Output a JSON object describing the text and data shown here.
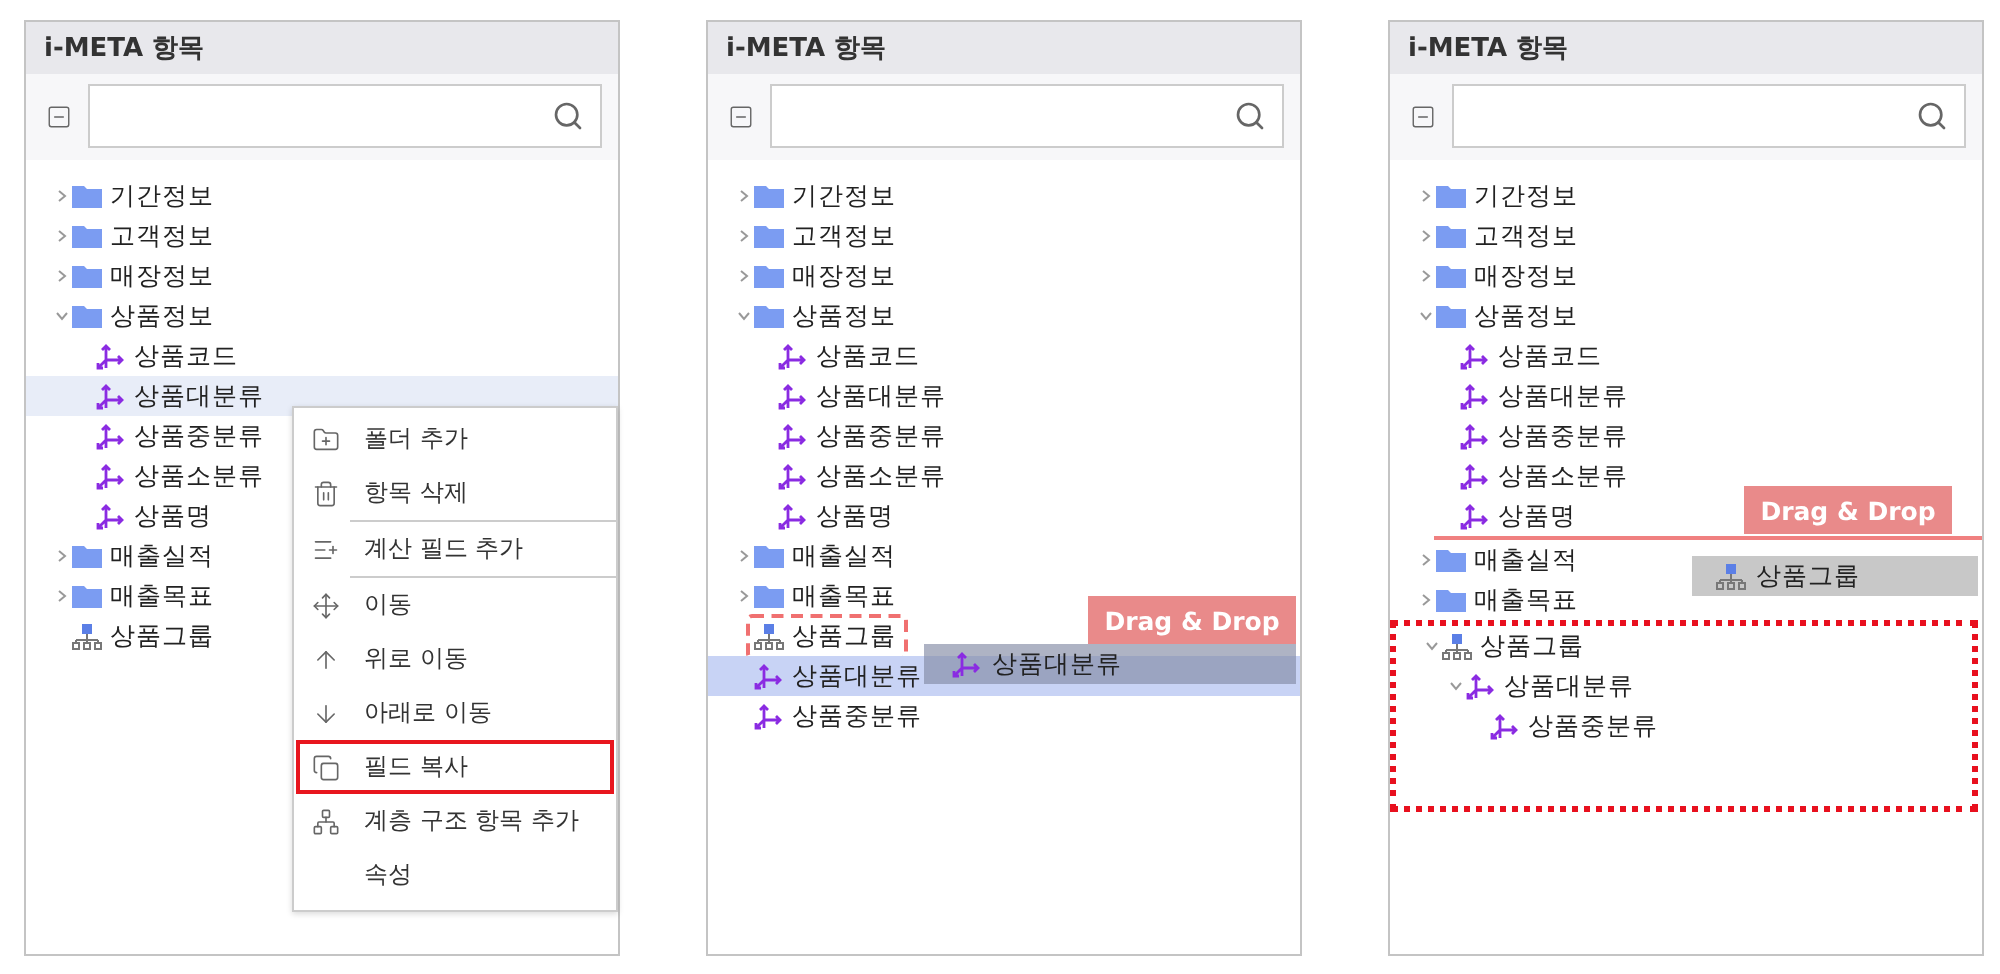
{
  "panels": [
    {
      "title": "i-META 항목",
      "tree": [
        {
          "label": "기간정보",
          "kind": "folder",
          "expanded": false,
          "selected": false
        },
        {
          "label": "고객정보",
          "kind": "folder",
          "expanded": false,
          "selected": false
        },
        {
          "label": "매장정보",
          "kind": "folder",
          "expanded": false,
          "selected": false
        },
        {
          "label": "상품정보",
          "kind": "folder",
          "expanded": true,
          "selected": false,
          "children": [
            {
              "label": "상품코드",
              "kind": "field",
              "selected": false
            },
            {
              "label": "상품대분류",
              "kind": "field",
              "selected": true
            },
            {
              "label": "상품중분류",
              "kind": "field",
              "selected": false
            },
            {
              "label": "상품소분류",
              "kind": "field",
              "selected": false
            },
            {
              "label": "상품명",
              "kind": "field",
              "selected": false
            }
          ]
        },
        {
          "label": "매출실적",
          "kind": "folder",
          "expanded": false,
          "selected": false
        },
        {
          "label": "매출목표",
          "kind": "folder",
          "expanded": false,
          "selected": false
        },
        {
          "label": "상품그룹",
          "kind": "hierarchy",
          "selected": false
        }
      ],
      "context_menu": [
        {
          "label": "폴더 추가",
          "kind": "folder-add",
          "highlighted": false,
          "divider_after": false
        },
        {
          "label": "항목 삭제",
          "kind": "delete",
          "highlighted": false,
          "divider_after": true
        },
        {
          "label": "계산 필드 추가",
          "kind": "calc-field",
          "highlighted": false,
          "divider_after": true
        },
        {
          "label": "이동",
          "kind": "move",
          "highlighted": false,
          "divider_after": false
        },
        {
          "label": "위로 이동",
          "kind": "up",
          "highlighted": false,
          "divider_after": false
        },
        {
          "label": "아래로 이동",
          "kind": "down",
          "highlighted": false,
          "divider_after": false
        },
        {
          "label": "필드 복사",
          "kind": "copy",
          "highlighted": true,
          "divider_after": false
        },
        {
          "label": "계층 구조 항목 추가",
          "kind": "hierarchy",
          "highlighted": false,
          "divider_after": false
        },
        {
          "label": "속성",
          "kind": "none",
          "highlighted": false,
          "divider_after": false
        }
      ]
    },
    {
      "title": "i-META 항목",
      "tree": [
        {
          "label": "기간정보",
          "kind": "folder",
          "expanded": false,
          "selected": false
        },
        {
          "label": "고객정보",
          "kind": "folder",
          "expanded": false,
          "selected": false
        },
        {
          "label": "매장정보",
          "kind": "folder",
          "expanded": false,
          "selected": false
        },
        {
          "label": "상품정보",
          "kind": "folder",
          "expanded": true,
          "selected": false,
          "children": [
            {
              "label": "상품코드",
              "kind": "field",
              "selected": false
            },
            {
              "label": "상품대분류",
              "kind": "field",
              "selected": false
            },
            {
              "label": "상품중분류",
              "kind": "field",
              "selected": false
            },
            {
              "label": "상품소분류",
              "kind": "field",
              "selected": false
            },
            {
              "label": "상품명",
              "kind": "field",
              "selected": false
            }
          ]
        },
        {
          "label": "매출실적",
          "kind": "folder",
          "expanded": false,
          "selected": false
        },
        {
          "label": "매출목표",
          "kind": "folder",
          "expanded": false,
          "selected": false
        },
        {
          "label": "상품그룹",
          "kind": "hierarchy",
          "selected": false,
          "drop_target": true
        },
        {
          "label": "상품대분류",
          "kind": "field",
          "selected": true
        },
        {
          "label": "상품중분류",
          "kind": "field",
          "selected": false
        }
      ],
      "drag": {
        "hint": "Drag & Drop",
        "label": "상품대분류",
        "kind": "field",
        "dropping_into": true
      }
    },
    {
      "title": "i-META 항목",
      "tree": [
        {
          "label": "기간정보",
          "kind": "folder",
          "expanded": false,
          "selected": false
        },
        {
          "label": "고객정보",
          "kind": "folder",
          "expanded": false,
          "selected": false
        },
        {
          "label": "매장정보",
          "kind": "folder",
          "expanded": false,
          "selected": false
        },
        {
          "label": "상품정보",
          "kind": "folder",
          "expanded": true,
          "selected": false,
          "children": [
            {
              "label": "상품코드",
              "kind": "field",
              "selected": false
            },
            {
              "label": "상품대분류",
              "kind": "field",
              "selected": false
            },
            {
              "label": "상품중분류",
              "kind": "field",
              "selected": false
            },
            {
              "label": "상품소분류",
              "kind": "field",
              "selected": false
            },
            {
              "label": "상품명",
              "kind": "field",
              "selected": false,
              "drop_line": true
            }
          ]
        },
        {
          "label": "매출실적",
          "kind": "folder",
          "expanded": false,
          "selected": false
        },
        {
          "label": "매출목표",
          "kind": "folder",
          "expanded": false,
          "selected": false
        },
        {
          "label": "상품그룹",
          "kind": "hierarchy",
          "expanded": true,
          "selected": false,
          "drop_target": true,
          "children": [
            {
              "label": "상품대분류",
              "kind": "field",
              "expanded": true,
              "selected": false,
              "children": [
                {
                  "label": "상품중분류",
                  "kind": "field",
                  "selected": false
                }
              ]
            }
          ]
        }
      ],
      "drag": {
        "hint": "Drag & Drop",
        "label": "상품그룹",
        "kind": "hierarchy",
        "dropping_into": false
      }
    }
  ]
}
